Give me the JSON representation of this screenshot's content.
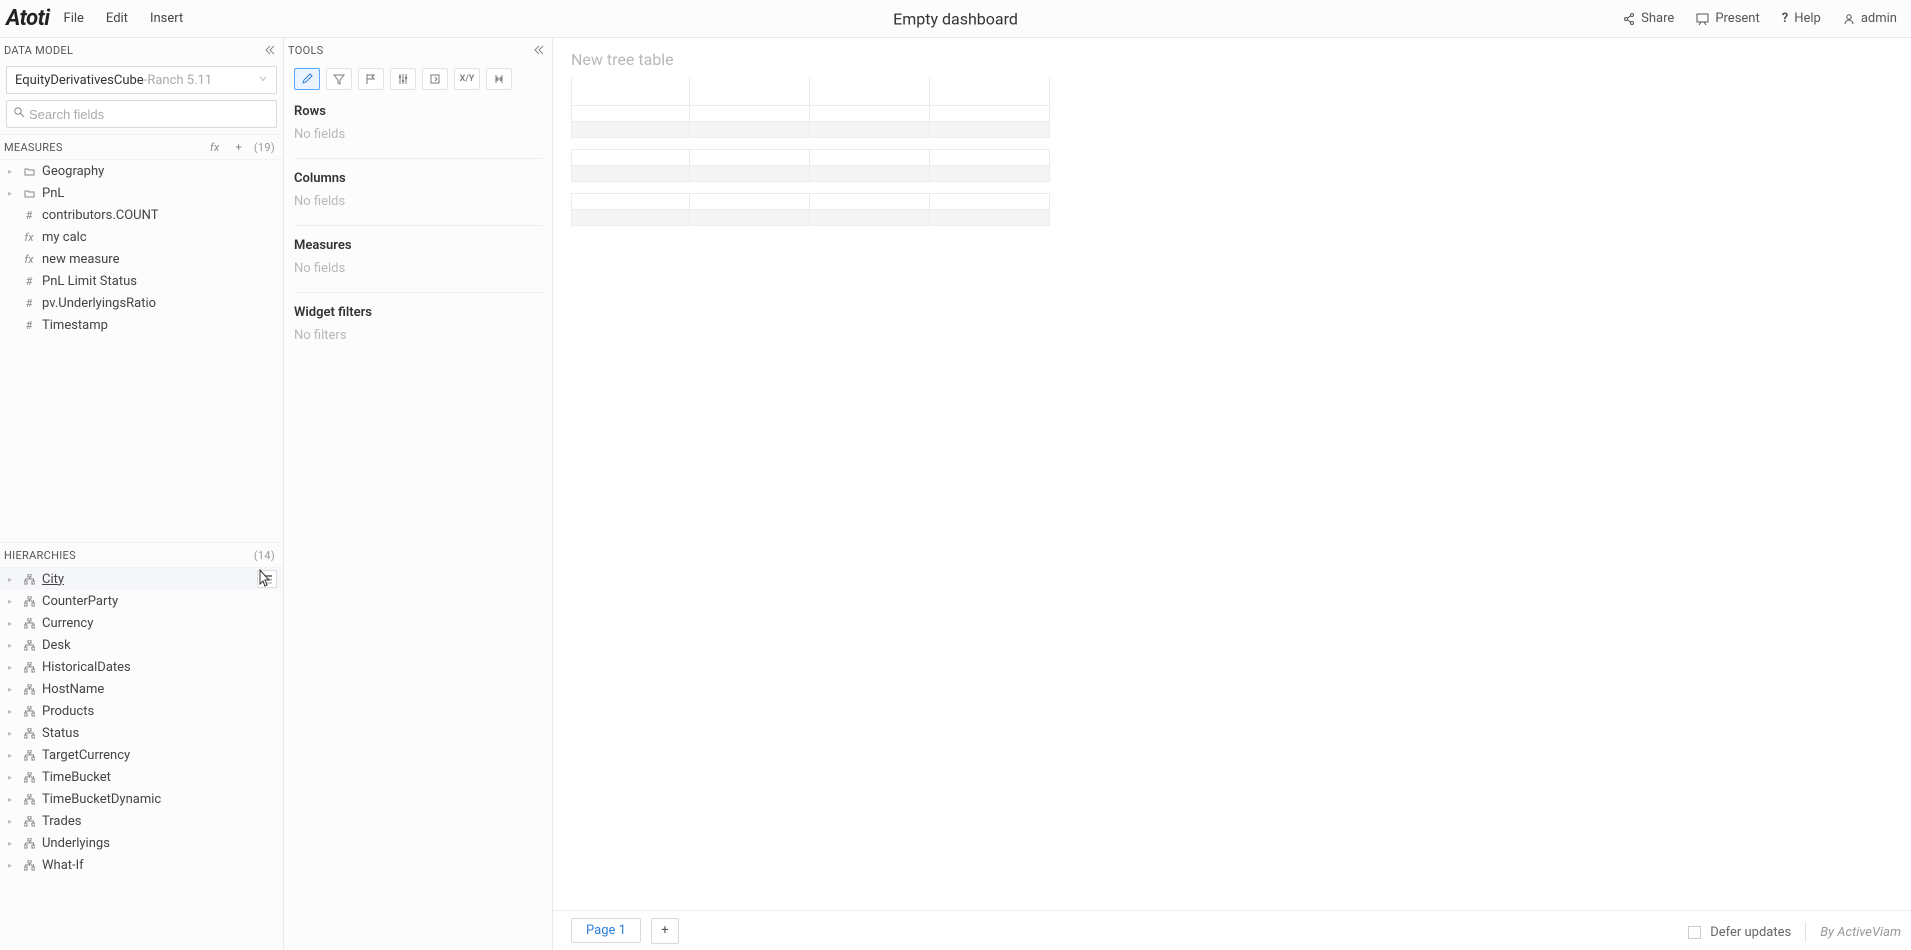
{
  "app": {
    "name": "Atoti"
  },
  "menu": {
    "file": "File",
    "edit": "Edit",
    "insert": "Insert"
  },
  "dashboard_title": "Empty dashboard",
  "top_right": {
    "share": "Share",
    "present": "Present",
    "help": "Help",
    "user": "admin"
  },
  "data_model": {
    "title": "DATA MODEL",
    "cube": {
      "name": "EquityDerivativesCube",
      "separator": " - ",
      "version": "Ranch 5.11"
    },
    "search_placeholder": "Search fields",
    "measures": {
      "title": "MEASURES",
      "count": "(19)",
      "items": [
        {
          "icon": "folder",
          "label": "Geography"
        },
        {
          "icon": "folder",
          "label": "PnL"
        },
        {
          "icon": "hash",
          "label": "contributors.COUNT"
        },
        {
          "icon": "fx",
          "label": "my calc"
        },
        {
          "icon": "fx",
          "label": "new measure"
        },
        {
          "icon": "hash",
          "label": "PnL Limit Status"
        },
        {
          "icon": "hash",
          "label": "pv.UnderlyingsRatio"
        },
        {
          "icon": "hash",
          "label": "Timestamp"
        }
      ]
    },
    "hierarchies": {
      "title": "HIERARCHIES",
      "count": "(14)",
      "items": [
        {
          "label": "City",
          "hovered": true
        },
        {
          "label": "CounterParty"
        },
        {
          "label": "Currency"
        },
        {
          "label": "Desk"
        },
        {
          "label": "HistoricalDates"
        },
        {
          "label": "HostName"
        },
        {
          "label": "Products"
        },
        {
          "label": "Status"
        },
        {
          "label": "TargetCurrency"
        },
        {
          "label": "TimeBucket"
        },
        {
          "label": "TimeBucketDynamic"
        },
        {
          "label": "Trades"
        },
        {
          "label": "Underlyings"
        },
        {
          "label": "What-If"
        }
      ]
    }
  },
  "tools": {
    "title": "TOOLS",
    "zones": {
      "rows": {
        "label": "Rows",
        "empty": "No fields"
      },
      "columns": {
        "label": "Columns",
        "empty": "No fields"
      },
      "measures": {
        "label": "Measures",
        "empty": "No fields"
      },
      "filters": {
        "label": "Widget filters",
        "empty": "No filters"
      }
    },
    "xy_label": "X/Y"
  },
  "content": {
    "widget_title_placeholder": "New tree table"
  },
  "footer": {
    "page": "Page 1",
    "defer": "Defer updates",
    "by": "By ActiveViam"
  }
}
